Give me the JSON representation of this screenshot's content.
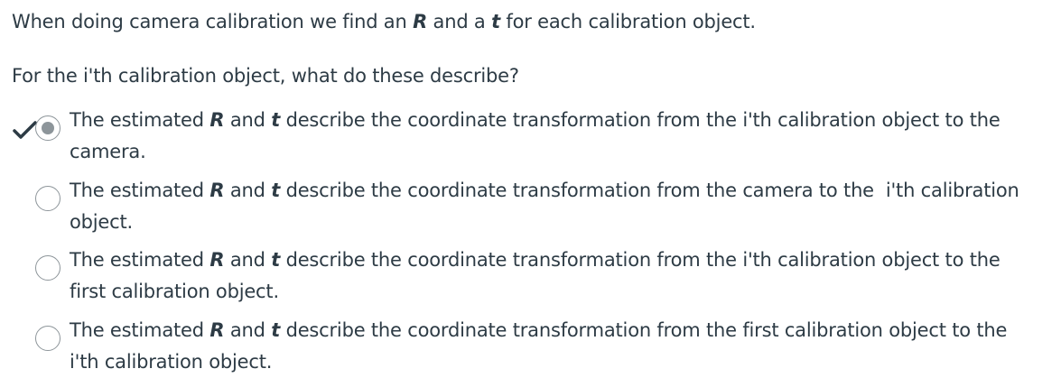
{
  "question": {
    "intro_before": "When doing camera calibration we find an",
    "intro_r": "R",
    "intro_mid": "and a",
    "intro_t": "t",
    "intro_after": "for each calibration object.",
    "prompt": "For the i'th calibration object, what do these describe?"
  },
  "answers": [
    {
      "prefix": "The estimated",
      "r": "R",
      "and": "and",
      "t": "t",
      "rest_line1": "describe the coordinate transformation from the i'th calibration object to the",
      "rest_line2": "camera.",
      "selected": true,
      "correct": true
    },
    {
      "prefix": "The estimated",
      "r": "R",
      "and": "and",
      "t": "t",
      "rest_line1": "describe the coordinate transformation from the camera to the  i'th calibration",
      "rest_line2": "object.",
      "selected": false,
      "correct": false
    },
    {
      "prefix": "The estimated",
      "r": "R",
      "and": "and",
      "t": "t",
      "rest_line1": "describe the coordinate transformation from the i'th calibration object to the",
      "rest_line2": "first calibration object.",
      "selected": false,
      "correct": false
    },
    {
      "prefix": "The estimated",
      "r": "R",
      "and": "and",
      "t": "t",
      "rest_line1": "describe the coordinate transformation from the first calibration object to the",
      "rest_line2": "i'th calibration object.",
      "selected": false,
      "correct": false
    }
  ],
  "colors": {
    "text": "#2d3b45",
    "radio_border": "#8d959a",
    "correct_check": "#2d3b45"
  },
  "icons": {
    "correct": "checkmark-icon",
    "radio": "radio-button"
  }
}
